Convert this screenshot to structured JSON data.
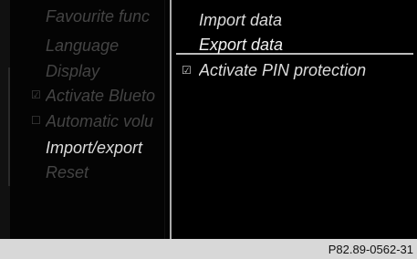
{
  "left_menu": {
    "items": [
      {
        "label": "Favourite func",
        "state": "dim"
      },
      {
        "label": "Language",
        "state": "dim"
      },
      {
        "label": "Display",
        "state": "dim"
      },
      {
        "label": "Activate Blueto",
        "state": "dim",
        "checkbox": "checked"
      },
      {
        "label": "Automatic volu",
        "state": "dim",
        "checkbox": "unchecked"
      },
      {
        "label": "Import/export",
        "state": "active"
      },
      {
        "label": "Reset",
        "state": "dim"
      }
    ]
  },
  "right_menu": {
    "items": [
      {
        "label": "Import data"
      },
      {
        "label": "Export data",
        "selected": true
      },
      {
        "label": "Activate PIN protection",
        "checkbox": "checked"
      }
    ]
  },
  "footer": {
    "ref": "P82.89-0562-31"
  },
  "icons": {
    "checkbox_checked": "checkbox-checked-icon",
    "checkbox_unchecked": "checkbox-unchecked-icon"
  },
  "colors": {
    "background": "#000000",
    "text_active": "#f2f2f2",
    "text_dim": "#444444",
    "footer_bg": "#d8d8d8"
  }
}
